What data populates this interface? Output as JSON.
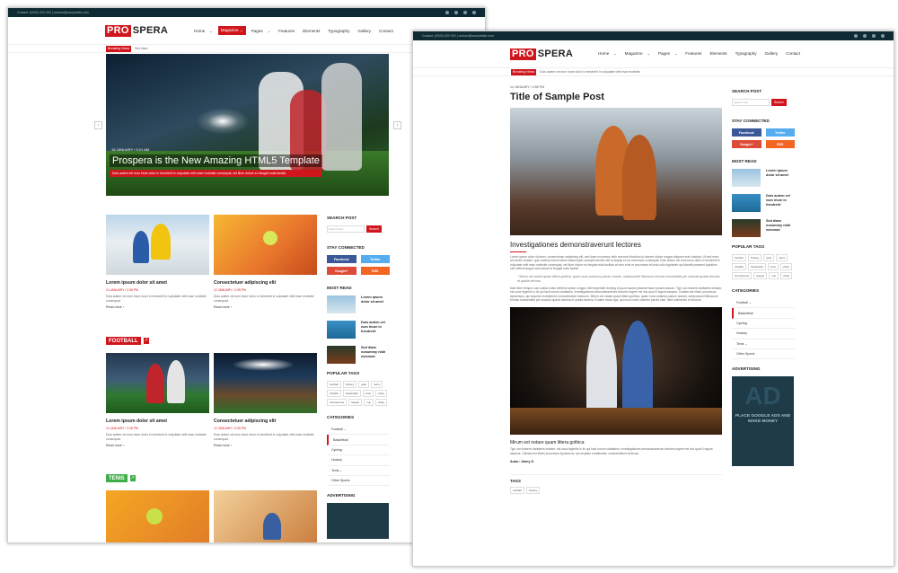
{
  "front": {
    "topbar": {
      "contact": "Contact: (0000) 000 000 | contact@samplesite.com"
    },
    "logo": {
      "pro": "PRO",
      "spera": "SPERA"
    },
    "nav": [
      "Home",
      "Magazine",
      "Pages",
      "Features",
      "Elements",
      "Typography",
      "Gallery",
      "Contact"
    ],
    "breaking": {
      "label": "Breaking News",
      "text": "Sed diam"
    },
    "hero": {
      "date": "15 JANUARY / 9:21 AM",
      "title": "Prospera is the New Amazing HTML5 Template",
      "sub": "Duis autem vel eum iriure dolor in hendrerit in vulputate velit esse molestie consequat, vel illum dolore eu feugiat nulla facilisi."
    },
    "cards": [
      {
        "title": "Lorem ipsum dolor sit amet",
        "date": "14 JANUARY / 2:36 PM",
        "text": "Duis autem vel eum iriure dolor in hendrerit in vulputate velit esse molestie consequat.",
        "more": "Read more ›"
      },
      {
        "title": "Consectetuer adipiscing elit",
        "date": "12 JANUARY / 2:05 PM",
        "text": "Duis autem vel eum iriure dolor in hendrerit in vulputate velit esse molestie consequat.",
        "more": "Read more ›"
      },
      {
        "title": "Lorem ipsum dolor sit amet",
        "date": "14 JANUARY / 2:26 PM",
        "text": "Duis autem vel eum iriure dolor in hendrerit in vulputate velit esse molestie consequat.",
        "more": "Read more ›"
      },
      {
        "title": "Consectetuer adipiscing elit",
        "date": "12 JANUARY / 2:05 PM",
        "text": "Duis autem vel eum iriure dolor in hendrerit in vulputate velit esse molestie consequat.",
        "more": "Read more ›"
      }
    ],
    "sections": {
      "football": "FOOTBALL",
      "tenis": "TENIS"
    }
  },
  "sidebar": {
    "search_title": "SEARCH POST",
    "search_placeholder": "Search here",
    "search_button": "Search",
    "stay_title": "STAY CONNECTED",
    "social": [
      "Facebook",
      "Twitter",
      "Google+",
      "RSS"
    ],
    "most_title": "MOST READ",
    "most": [
      "Lorem ipsum dolor sit amet",
      "Duis autem vel eum iriure in hendrerit",
      "Sed diam nonummy nibh euismod"
    ],
    "tags_title": "POPULAR TAGS",
    "tags": [
      "football",
      "hockey",
      "goal",
      "mano",
      "ciclable",
      "basketball",
      "tenis",
      "video",
      "championes",
      "league",
      "cup",
      "video"
    ],
    "cats_title": "CATEGORIES",
    "cats": [
      "Football",
      "Basketball",
      "Cycling",
      "Hockey",
      "Tenis",
      "Other Sports"
    ],
    "ad_title": "ADVERTISING",
    "ad_big": "AD",
    "ad_small": "PLACE GOOGLE ADS AND MAKE MONEY"
  },
  "back": {
    "topbar": {
      "contact": "Contact: (0000) 000 000 | contact@samplesite.com"
    },
    "breaking": {
      "label": "Breaking News",
      "text": "Duis autem vel eum iriure dolor in hendrerit in vulputate velit esse molestie"
    },
    "post": {
      "date": "14 JANUARY / 4:56 PM",
      "title": "Title of Sample Post",
      "h3": "Investigationes demonstraverunt lectores",
      "p1": "Lorem ipsum dolor sit amet, consectetuer adipiscing elit, sed diam nonummy nibh euismod tincidunt ut laoreet dolore magna aliquam erat volutpat. Ut wisi enim ad minim veniam, quis nostrud exerci tation ullamcorper suscipit lobortis nisl ut aliquip ex ea commodo consequat. Duis autem vel eum iriure dolor in hendrerit in vulputate velit esse molestie consequat, vel illum dolore eu feugiat nulla facilisis at vero eros et accumsan et iusto odio dignissim qui blandit praesent luptatum zzril delenit augue duis dolore te feugait nulla facilisi.",
      "quote": "Mirum est notare quam littera gothica, quam nunc putamus parum claram, anteposuerit litterarum formas humanitatis per seacula quarta decima et quinta decima.",
      "p2": "Nam liber tempor cum soluta nobis eleifend option congue nihil imperdiet doming id quod mazim placerat facer possim assum. Typi non habent claritatem insitam; est usus legentis in iis qui facit eorum claritatem. Investigationes demonstraverunt lectores legere me lius quod ii legunt saepius. Claritas est etiam processus dynamicus, qui sequitur mutationem consuetudium lectorum. Mirum est notare quam littera gothica, quam nunc putamus parum claram, anteposuerit litterarum formas humanitatis per seacula quarta decima et quinta decima. Eodem modo typi, qui nunc nobis videntur parum clari, fiant sollemnes in futurum.",
      "h4": "Mirum est notare quam littera gothica",
      "p3": "Typi non habent claritatem insitam; est usus legentis in iis qui facit eorum claritatem. Investigationes demonstraverunt lectores legere me lius quod ii legunt saepius. Claritas est etiam processus dynamicus, qui sequitur mutationem consuetudium lectorum.",
      "author": "Autor: Johny G.",
      "tags_title": "TAGS",
      "tags": [
        "football",
        "hockey"
      ]
    }
  },
  "colors": {
    "accent": "#d0161d",
    "facebook": "#3b5998",
    "twitter": "#55acee",
    "google": "#dd4b39",
    "rss": "#f26522",
    "football": "#d0161d",
    "tenis": "#3fae49"
  }
}
